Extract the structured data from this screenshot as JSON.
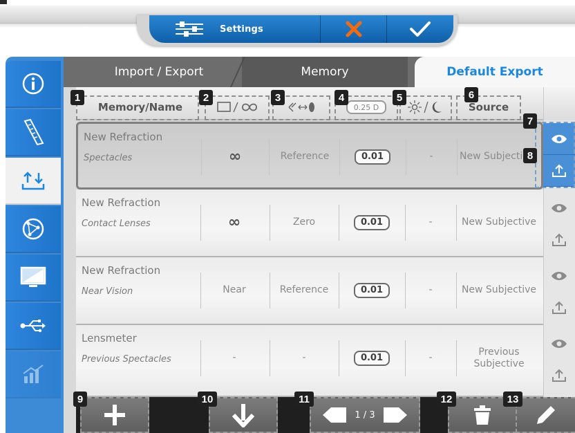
{
  "colors": {
    "accent_blue": "#1b88e0",
    "rail_blue": "#3d8ad7",
    "close_orange": "#f26b12",
    "callout_black": "#202020"
  },
  "top_bar": {
    "settings_label": "Settings",
    "settings_icon": "sliders-icon",
    "close_icon": "close-icon",
    "confirm_icon": "check-icon"
  },
  "side_rail": {
    "items": [
      {
        "icon": "info-icon",
        "active": false
      },
      {
        "icon": "ruler-icon",
        "active": false
      },
      {
        "icon": "import-export-icon",
        "active": true
      },
      {
        "icon": "network-icon",
        "active": false
      },
      {
        "icon": "monitor-icon",
        "active": false
      },
      {
        "icon": "usb-icon",
        "active": false
      },
      {
        "icon": "chart-icon",
        "active": false
      }
    ]
  },
  "tabs": [
    {
      "label": "Import / Export"
    },
    {
      "label": "Memory"
    },
    {
      "label": "Default Export"
    }
  ],
  "columns": {
    "memory_name": "Memory/Name",
    "distance_icon": "distance-infinity-icon",
    "vertex_icon": "vertex-eye-icon",
    "step_icon": "step-size-icon",
    "step_value": "0.25 D",
    "light_icon": "day-night-icon",
    "source": "Source"
  },
  "rows": [
    {
      "name": "New Refraction",
      "type": "Spectacles",
      "distance": "∞",
      "vertex": "Reference",
      "step": "0.01",
      "light": "-",
      "source": "New Subjecti",
      "selected": true,
      "view_on": true
    },
    {
      "name": "New Refraction",
      "type": "Contact Lenses",
      "distance": "∞",
      "vertex": "Zero",
      "step": "0.01",
      "light": "-",
      "source": "New Subjective",
      "selected": false,
      "view_on": false
    },
    {
      "name": "New Refraction",
      "type": "Near Vision",
      "distance": "Near",
      "vertex": "Reference",
      "step": "0.01",
      "light": "-",
      "source": "New Subjective",
      "selected": false,
      "view_on": false
    },
    {
      "name": "Lensmeter",
      "type": "Previous Spectacles",
      "distance": "-",
      "vertex": "-",
      "step": "0.01",
      "light": "-",
      "source": "Previous Subjective",
      "selected": false,
      "view_on": false
    }
  ],
  "callouts": [
    "1",
    "2",
    "3",
    "4",
    "5",
    "6",
    "7",
    "8",
    "9",
    "10",
    "11",
    "12",
    "13"
  ],
  "bottom_bar": {
    "add_icon": "plus-icon",
    "move_down_icon": "arrow-down-icon",
    "page_text": "1 / 3",
    "delete_icon": "trash-icon",
    "edit_icon": "pencil-icon"
  }
}
